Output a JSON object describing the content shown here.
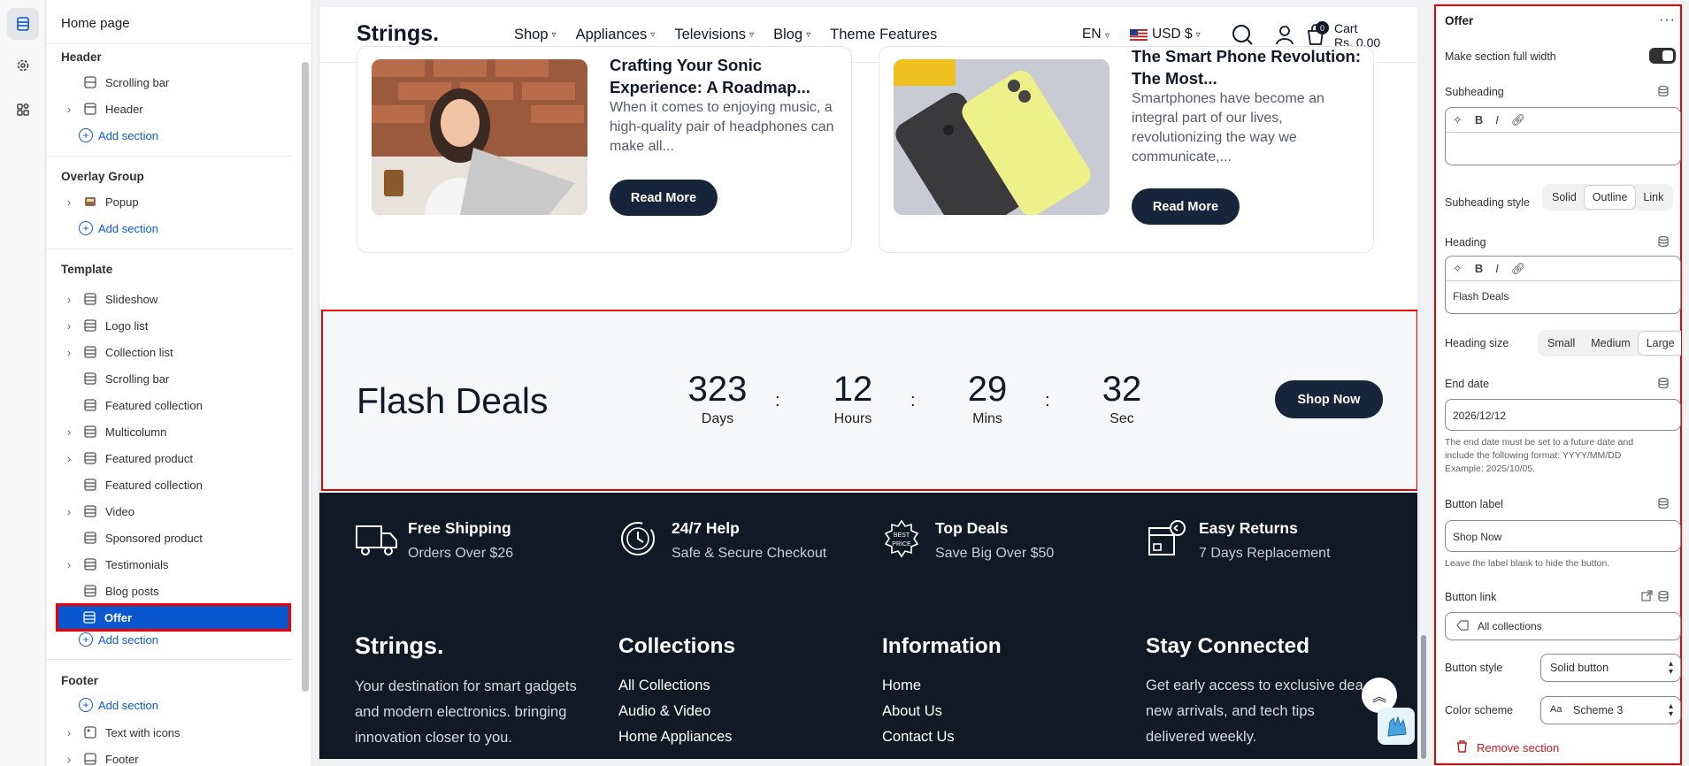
{
  "sidebar": {
    "title": "Home page",
    "groups": {
      "header": "Header",
      "overlay": "Overlay Group",
      "template": "Template",
      "footer": "Footer"
    },
    "header_items": [
      "Scrolling bar",
      "Header"
    ],
    "overlay_items": [
      "Popup"
    ],
    "template_items": [
      "Slideshow",
      "Logo list",
      "Collection list",
      "Scrolling bar",
      "Featured collection",
      "Multicolumn",
      "Featured product",
      "Featured collection",
      "Video",
      "Sponsored product",
      "Testimonials",
      "Blog posts",
      "Offer"
    ],
    "footer_items": [
      "Text with icons",
      "Footer"
    ],
    "add_section": "Add section"
  },
  "preview": {
    "logo": "Strings.",
    "menu": [
      "Shop",
      "Appliances",
      "Televisions",
      "Blog",
      "Theme Features"
    ],
    "lang": "EN",
    "currency": "USD $",
    "cart_label": "Cart",
    "cart_total": "Rs. 0.00",
    "cart_count": "0",
    "posts": [
      {
        "title": "Crafting Your Sonic Experience: A Roadmap...",
        "excerpt": "When it comes to enjoying music, a high-quality pair of headphones can make all...",
        "button": "Read More"
      },
      {
        "title": "The Smart Phone Revolution: The Most...",
        "excerpt": "Smartphones have become an integral part of our lives, revolutionizing the way we communicate,...",
        "button": "Read More"
      }
    ],
    "offer": {
      "heading": "Flash Deals",
      "countdown": [
        {
          "value": "323",
          "unit": "Days"
        },
        {
          "value": "12",
          "unit": "Hours"
        },
        {
          "value": "29",
          "unit": "Mins"
        },
        {
          "value": "32",
          "unit": "Sec"
        }
      ],
      "separator": ":",
      "button": "Shop Now"
    },
    "features": [
      {
        "title": "Free Shipping",
        "text": "Orders Over $26",
        "icon": "truck-icon"
      },
      {
        "title": "24/7 Help",
        "text": "Safe & Secure Checkout",
        "icon": "clock-icon"
      },
      {
        "title": "Top Deals",
        "text": "Save Big Over $50",
        "icon": "best-price-icon"
      },
      {
        "title": "Easy Returns",
        "text": "7 Days Replacement",
        "icon": "return-box-icon"
      }
    ],
    "footer": {
      "brand": "Strings.",
      "about": [
        "Your destination for smart gadgets",
        "and modern electronics. bringing",
        "innovation closer to you."
      ],
      "collections_title": "Collections",
      "collections": [
        "All Collections",
        "Audio & Video",
        "Home Appliances"
      ],
      "info_title": "Information",
      "info": [
        "Home",
        "About Us",
        "Contact Us"
      ],
      "stay_title": "Stay Connected",
      "stay": [
        "Get early access to exclusive dea",
        "new arrivals, and tech tips",
        "delivered weekly."
      ]
    },
    "best_badge_line1": "BEST",
    "best_badge_line2": "PRICE"
  },
  "settings": {
    "title": "Offer",
    "full_width_label": "Make section full width",
    "full_width_on": true,
    "subheading_label": "Subheading",
    "subheading_value": "",
    "subheading_style_label": "Subheading style",
    "subheading_style_options": [
      "Solid",
      "Outline",
      "Link"
    ],
    "subheading_style_selected": "Outline",
    "heading_label": "Heading",
    "heading_value": "Flash Deals",
    "heading_size_label": "Heading size",
    "heading_size_options": [
      "Small",
      "Medium",
      "Large"
    ],
    "heading_size_selected": "Large",
    "end_date_label": "End date",
    "end_date_value": "2026/12/12",
    "end_date_hint": "The end date must be set to a future date and include the following format: YYYY/MM/DD Example: 2025/10/05.",
    "button_label_label": "Button label",
    "button_label_value": "Shop Now",
    "button_label_hint": "Leave the label blank to hide the button.",
    "button_link_label": "Button link",
    "button_link_value": "All collections",
    "button_style_label": "Button style",
    "button_style_value": "Solid button",
    "color_scheme_label": "Color scheme",
    "color_scheme_value": "Scheme 3",
    "remove_label": "Remove section"
  }
}
